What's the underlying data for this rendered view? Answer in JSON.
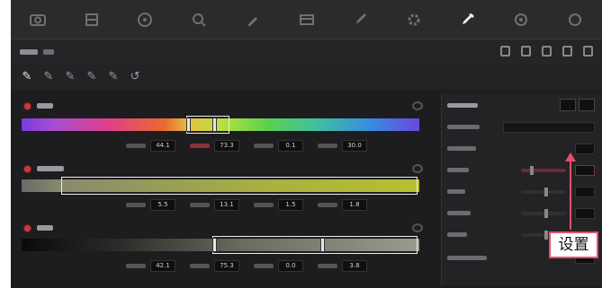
{
  "colors": {
    "accent": "#e8506a",
    "panel_bg": "#1d1d1f",
    "toolbar_bg": "#2b2b2e"
  },
  "toolbar": {
    "icons": [
      "camera-icon",
      "film-icon",
      "circle-icon",
      "zoom-icon",
      "pen-icon",
      "frame-icon",
      "brush-icon",
      "gear-icon",
      "eyedropper-icon",
      "settings-icon",
      "settings-label"
    ],
    "active_index": 8
  },
  "hue": {
    "values": [
      "44.1",
      "73.3",
      "0.1",
      "30.0"
    ]
  },
  "saturation": {
    "values": [
      "5.5",
      "13.1",
      "1.5",
      "1.8"
    ]
  },
  "luminance": {
    "values": [
      "42.1",
      "75.3",
      "0.0",
      "3.8"
    ]
  },
  "annotation": {
    "label": "设置"
  }
}
